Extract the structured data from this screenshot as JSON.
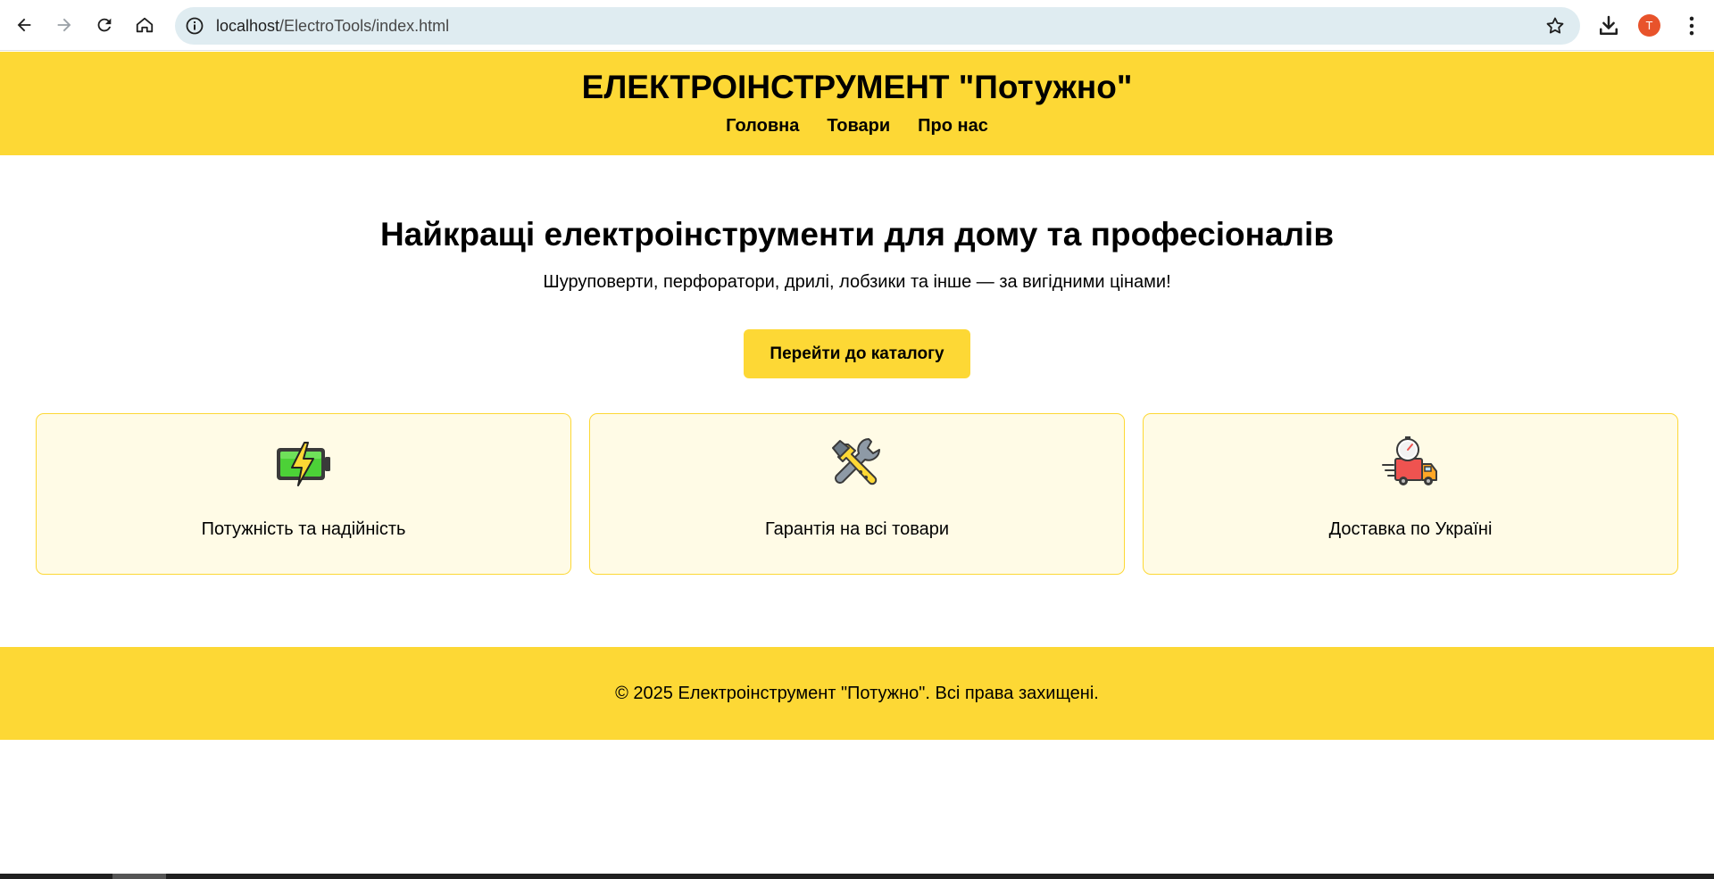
{
  "browser": {
    "url_host": "localhost",
    "url_path": "/ElectroTools/index.html",
    "avatar_letter": "T",
    "avatar_color": "#e8532b"
  },
  "header": {
    "title": "ЕЛЕКТРОІНСТРУМЕНТ \"Потужно\"",
    "nav": [
      "Головна",
      "Товари",
      "Про нас"
    ]
  },
  "hero": {
    "title": "Найкращі електроінструменти для дому та професіоналів",
    "subtitle": "Шуруповерти, перфоратори, дрилі, лобзики та інше — за вигідними цінами!",
    "cta_label": "Перейти до каталогу"
  },
  "features": [
    {
      "icon": "battery-lightning-icon",
      "label": "Потужність та надійність"
    },
    {
      "icon": "hammer-wrench-icon",
      "label": "Гарантія на всі товари"
    },
    {
      "icon": "delivery-truck-icon",
      "label": "Доставка по Україні"
    }
  ],
  "footer": {
    "text": "© 2025 Електроінструмент \"Потужно\". Всі права захищені."
  },
  "colors": {
    "accent": "#fdd835",
    "card_bg": "#fffbe6"
  }
}
